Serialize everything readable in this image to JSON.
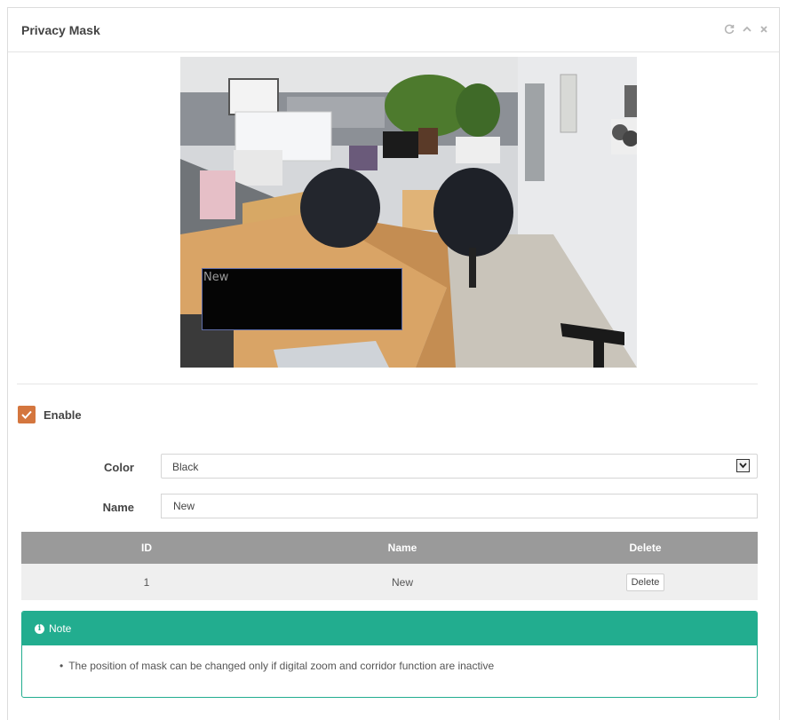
{
  "panel": {
    "title": "Privacy Mask",
    "icons": [
      "refresh-icon",
      "collapse-icon",
      "close-icon"
    ]
  },
  "preview": {
    "mask_label": "New"
  },
  "enable": {
    "label": "Enable",
    "checked": true
  },
  "form": {
    "color_label": "Color",
    "color_value": "Black",
    "name_label": "Name",
    "name_value": "New"
  },
  "table": {
    "headers": {
      "id": "ID",
      "name": "Name",
      "delete": "Delete"
    },
    "rows": [
      {
        "id": "1",
        "name": "New",
        "delete_label": "Delete"
      }
    ]
  },
  "note": {
    "title": "Note",
    "items": [
      "The position of mask can be changed only if digital zoom and corridor function are inactive"
    ]
  },
  "colors": {
    "accent": "#d4763e",
    "note": "#22ad8f",
    "table_header": "#9a9a9a"
  }
}
